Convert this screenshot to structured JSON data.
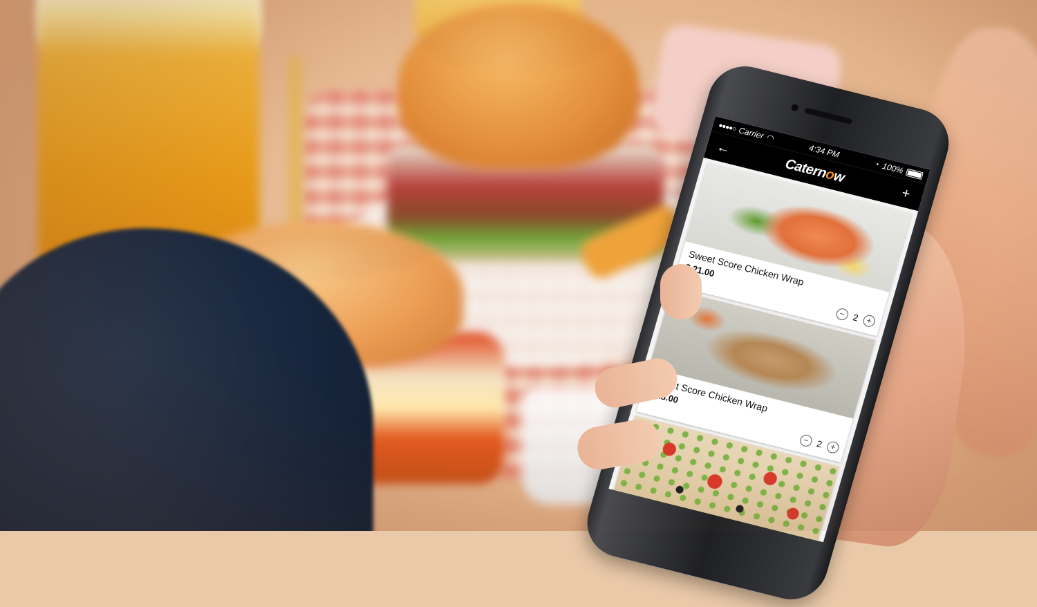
{
  "app": {
    "status": {
      "carrier": "Carrier",
      "time": "4:34 PM",
      "battery": "100%"
    },
    "nav": {
      "back_icon": "←",
      "logo_prefix": "Catern",
      "logo_o": "o",
      "logo_suffix": "w",
      "add_icon": "+"
    },
    "items": [
      {
        "name": "Sweet Score Chicken Wrap",
        "price": "$ 21.00",
        "quantity": "2",
        "image": "grilled-salmon-image"
      },
      {
        "name": "Sweet Score Chicken Wrap",
        "price": "$ 18.00",
        "quantity": "2",
        "image": "chicken-wrap-image"
      },
      {
        "name": "",
        "price": "",
        "quantity": "",
        "image": "salad-image"
      }
    ],
    "stepper": {
      "minus": "−",
      "plus": "+"
    }
  }
}
